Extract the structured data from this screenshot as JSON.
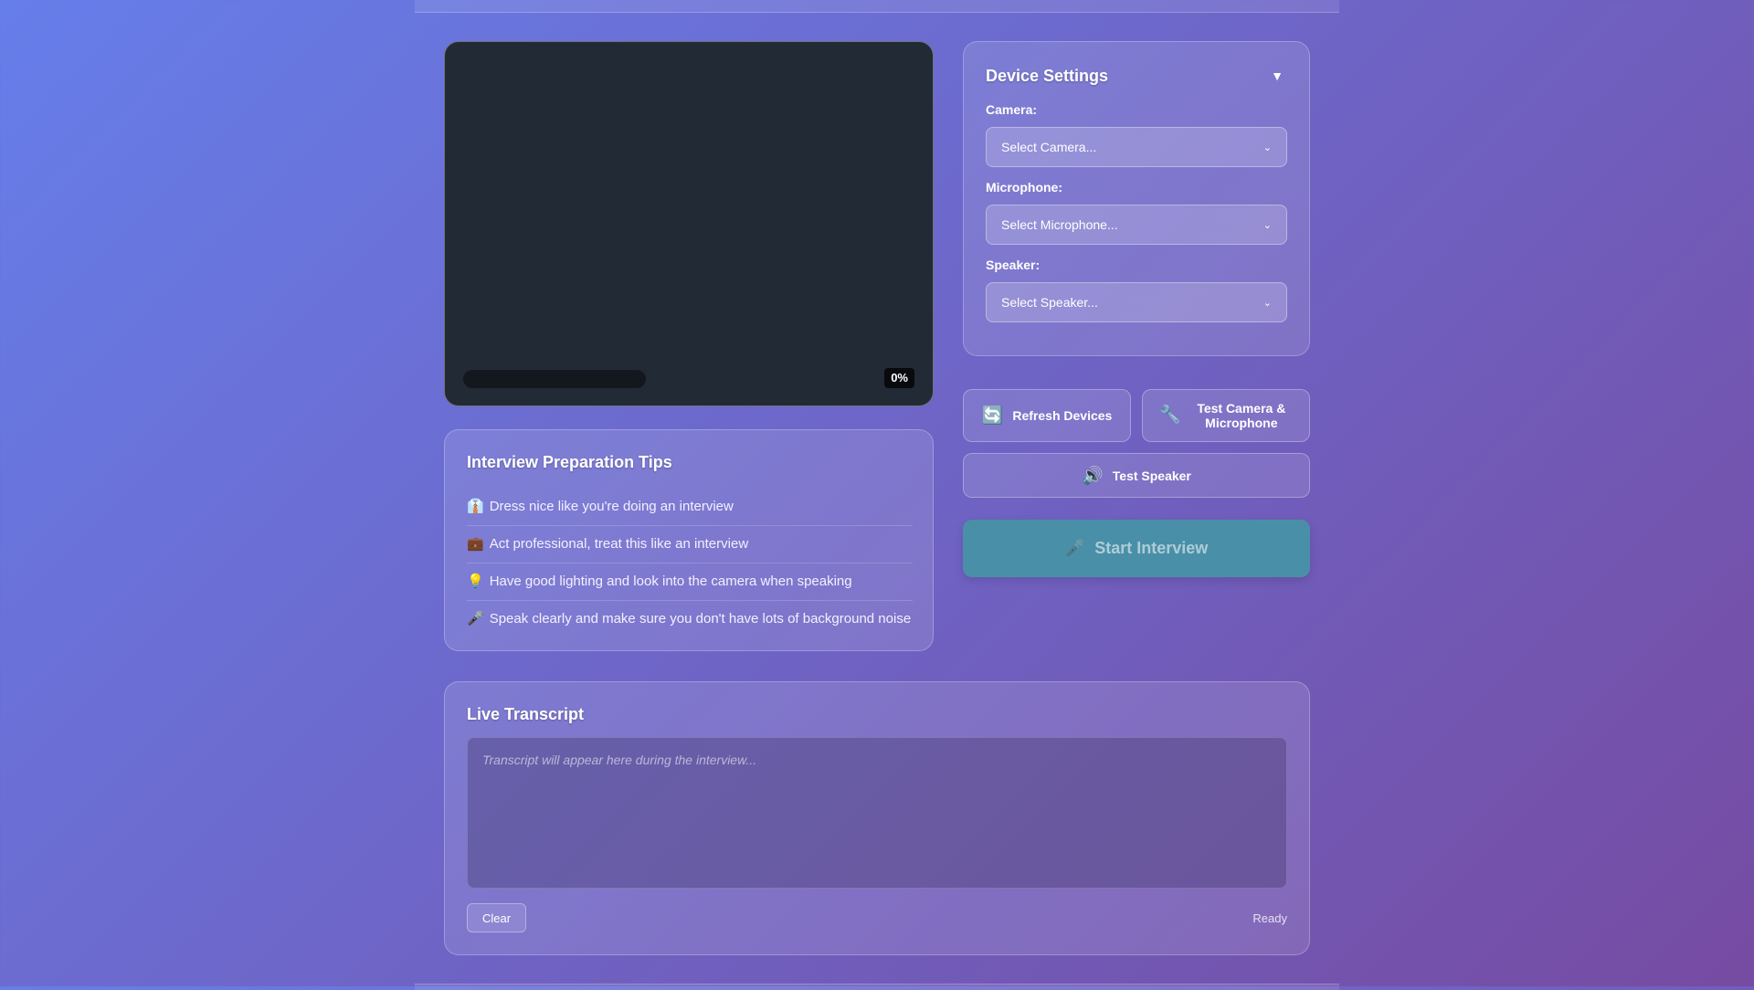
{
  "video": {
    "volume_label": "0%",
    "volume_level": 0
  },
  "device_settings": {
    "title": "Device Settings",
    "toggle_icon": "▼",
    "camera_label": "Camera:",
    "camera_value": "Select Camera...",
    "microphone_label": "Microphone:",
    "microphone_value": "Select Microphone...",
    "speaker_label": "Speaker:",
    "speaker_value": "Select Speaker..."
  },
  "actions": {
    "refresh_icon": "🔄",
    "refresh_label": "Refresh Devices",
    "test_icon": "🔧",
    "test_label": "Test Camera & Microphone",
    "test_speaker_icon": "🔊",
    "test_speaker_label": "Test Speaker",
    "start_icon": "🎤",
    "start_label": "Start Interview"
  },
  "tips": {
    "title": "Interview Preparation Tips",
    "items": [
      {
        "icon": "👔",
        "text": "Dress nice like you're doing an interview"
      },
      {
        "icon": "💼",
        "text": "Act professional, treat this like an interview"
      },
      {
        "icon": "💡",
        "text": "Have good lighting and look into the camera when speaking"
      },
      {
        "icon": "🎤",
        "text": "Speak clearly and make sure you don't have lots of background noise"
      }
    ]
  },
  "transcript": {
    "title": "Live Transcript",
    "placeholder": "Transcript will appear here during the interview...",
    "clear_label": "Clear",
    "status": "Ready"
  },
  "colors": {
    "background_start": "#667eea",
    "background_end": "#764ba2",
    "video_bg": "#222a36",
    "start_button": "#4a8fa8"
  }
}
